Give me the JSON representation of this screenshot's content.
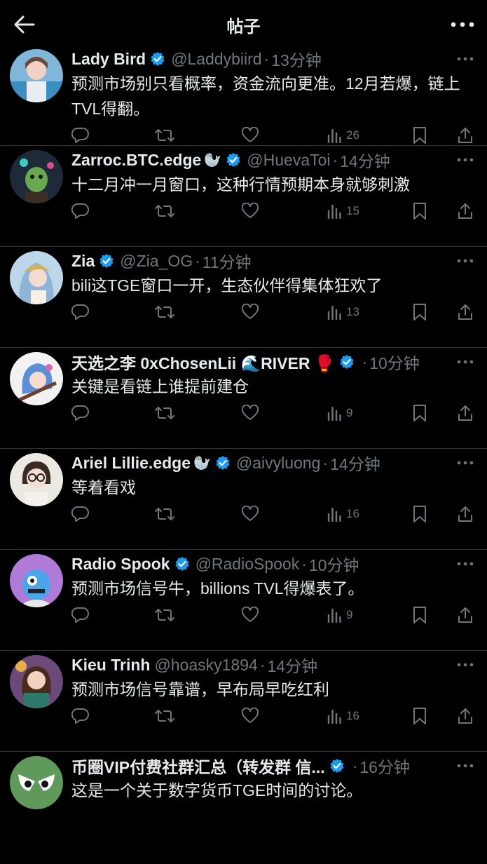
{
  "header": {
    "title": "帖子",
    "back_icon": "arrow-left-icon",
    "more_icon": "more-horizontal-icon"
  },
  "colors": {
    "background": "#000000",
    "text": "#e7e9ea",
    "muted": "#71767b",
    "verified": "#1d9bf0",
    "divider": "#2f3336"
  },
  "posts": [
    {
      "name": "Lady Bird",
      "verified": true,
      "handle": "@Laddybiird",
      "dot": "·",
      "time": "13分钟",
      "text": "预测市场别只看概率，资金流向更准。12月若爆，链上TVL得翻。",
      "views": "26"
    },
    {
      "name": "Zarroc.BTC.edge",
      "emoji": "🦭",
      "verified": true,
      "handle": "@HuevaToi",
      "dot": "·",
      "time": "14分钟",
      "text": "十二月冲一月窗口，这种行情预期本身就够刺激",
      "views": "15"
    },
    {
      "name": "Zia",
      "verified": true,
      "handle": "@Zia_OG",
      "dot": "·",
      "time": "11分钟",
      "text": "bili这TGE窗口一开，生态伙伴得集体狂欢了",
      "views": "13"
    },
    {
      "name": "天选之李 0xChosenLii 🌊RIVER 🥊",
      "verified": true,
      "handle": "",
      "dot": "·",
      "time": "10分钟",
      "text": "关键是看链上谁提前建仓",
      "views": "9"
    },
    {
      "name": "Ariel Lillie.edge",
      "emoji": "🦭",
      "verified": true,
      "handle": "@aivyluong",
      "dot": "·",
      "time": "14分钟",
      "text": "等着看戏",
      "views": "16"
    },
    {
      "name": "Radio Spook",
      "verified": true,
      "handle": "@RadioSpook",
      "dot": "·",
      "time": "10分钟",
      "text": "预测市场信号牛，billions TVL得爆表了。",
      "views": "9"
    },
    {
      "name": "Kieu Trinh",
      "verified": false,
      "handle": "@hoasky1894",
      "dot": "·",
      "time": "14分钟",
      "text": "预测市场信号靠谱，早布局早吃红利",
      "views": "16"
    },
    {
      "name": "币圈VIP付费社群汇总（转发群 信...",
      "verified": true,
      "handle": "",
      "dot": "·",
      "time": "16分钟",
      "text": "这是一个关于数字货币TGE时间的讨论。",
      "views": ""
    }
  ]
}
